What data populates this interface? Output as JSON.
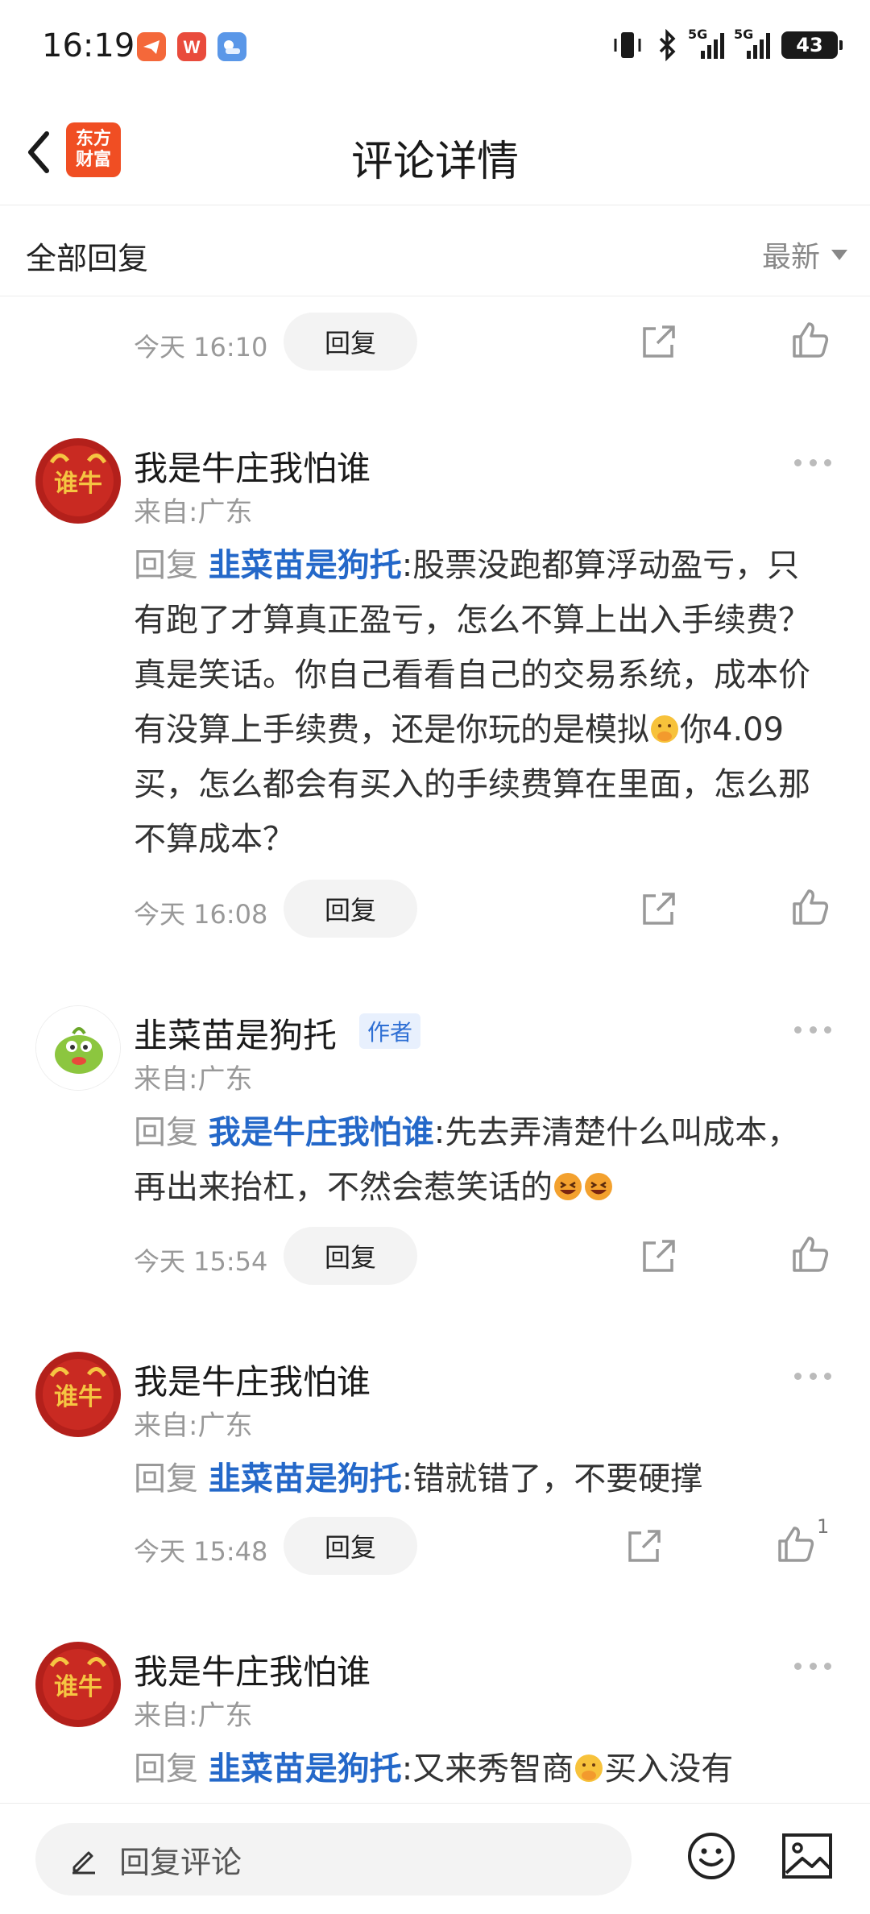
{
  "status_bar": {
    "time": "16:19",
    "battery": "43",
    "signal_1": "5G",
    "signal_2": "5G",
    "icons": [
      "vibrate-icon",
      "bluetooth-icon"
    ]
  },
  "nav": {
    "title": "评论详情",
    "logo_line1": "东方",
    "logo_line2": "财富"
  },
  "filter": {
    "title": "全部回复",
    "sort_label": "最新"
  },
  "comments": [
    {
      "time": "今天 16:10",
      "reply_label": "回复"
    },
    {
      "user": "我是牛庄我怕谁",
      "location": "来自:广东",
      "reply_prefix": "回复 ",
      "mention": "韭菜苗是狗托",
      "text_a": ":股票没跑都算浮动盈亏，只有跑了才算真正盈亏，怎么不算上出入手续费？真是笑话。你自己看看自己的交易系统，成本价有没算上手续费，还是你玩的是模拟",
      "text_b": "你4.09买，怎么都会有买入的手续费算在里面，怎么那不算成本？",
      "time": "今天 16:08",
      "reply_label": "回复"
    },
    {
      "user": "韭菜苗是狗托",
      "badge": "作者",
      "location": "来自:广东",
      "reply_prefix": "回复 ",
      "mention": "我是牛庄我怕谁",
      "text_a": ":先去弄清楚什么叫成本，再出来抬杠，不然会惹笑话的",
      "time": "今天 15:54",
      "reply_label": "回复"
    },
    {
      "user": "我是牛庄我怕谁",
      "location": "来自:广东",
      "reply_prefix": "回复 ",
      "mention": "韭菜苗是狗托",
      "text_a": ":错就错了，不要硬撑",
      "time": "今天 15:48",
      "reply_label": "回复",
      "likes": "1"
    },
    {
      "user": "我是牛庄我怕谁",
      "location": "来自:广东",
      "reply_prefix": "回复 ",
      "mention": "韭菜苗是狗托",
      "text_a": ":又来秀智商",
      "text_b": "买入没有"
    }
  ],
  "avatar_text": "谁牛",
  "bottom_bar": {
    "placeholder": "回复评论"
  },
  "colors": {
    "mention": "#2468c9",
    "accent": "#f04e23",
    "avatar_red": "#b3201b"
  }
}
